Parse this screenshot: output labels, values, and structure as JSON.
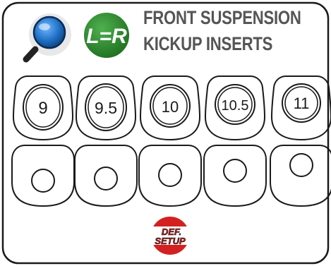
{
  "title": {
    "line1": "FRONT SUSPENSION",
    "line2": "KICKUP INSERTS"
  },
  "badges": {
    "zoom_icon": "magnifier-icon",
    "symmetry_label": "L=R",
    "symmetry_color": "#2e8b2e"
  },
  "inserts": [
    {
      "label": "9"
    },
    {
      "label": "9.5"
    },
    {
      "label": "10"
    },
    {
      "label": "10.5"
    },
    {
      "label": "11"
    }
  ],
  "default_setup": {
    "line1": "DEF.",
    "line2": "SETUP",
    "color": "#d32020"
  },
  "colors": {
    "outline": "#1a1a1a",
    "title": "#555555",
    "magnifier_blue": "#1e6fc4"
  }
}
